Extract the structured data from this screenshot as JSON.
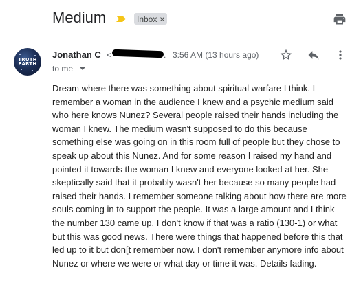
{
  "subject": {
    "title": "Medium",
    "label_chip": "Inbox",
    "label_remove": "×",
    "importance_color": "#f5c518",
    "icons": [
      "importance-marker-icon",
      "print-icon"
    ]
  },
  "message": {
    "avatar_text": "TRUTH EARTH",
    "sender_name": "Jonathan C",
    "sender_email_prefix": "<",
    "sender_email_suffix": ".",
    "timestamp": "3:56 AM (13 hours ago)",
    "recipient": "to me",
    "icons": [
      "star-icon",
      "reply-icon",
      "more-vert-icon",
      "chevron-down-icon"
    ],
    "body": "Dream where there was something about spiritual warfare I think. I remember a woman in the audience I knew and a psychic medium said who here knows Nunez? Several people raised their hands including the woman I knew. The medium wasn't supposed to do this because something else was going on in this room full of people but they chose to speak up about this Nunez. And for some reason I raised my hand and pointed it towards the woman I knew and everyone looked at her. She skeptically said that it probably wasn't her because so many people had raised their hands. I remember someone talking about how there are more souls coming in to support the people. It was a large amount and I think the number 130 came up. I don't know if that was a ratio (130-1) or what but this was good news. There were things that happened before this that led up to it but don[t remember now. I don't remember anymore info about Nunez or where we were or what day or time it was. Details fading."
  }
}
